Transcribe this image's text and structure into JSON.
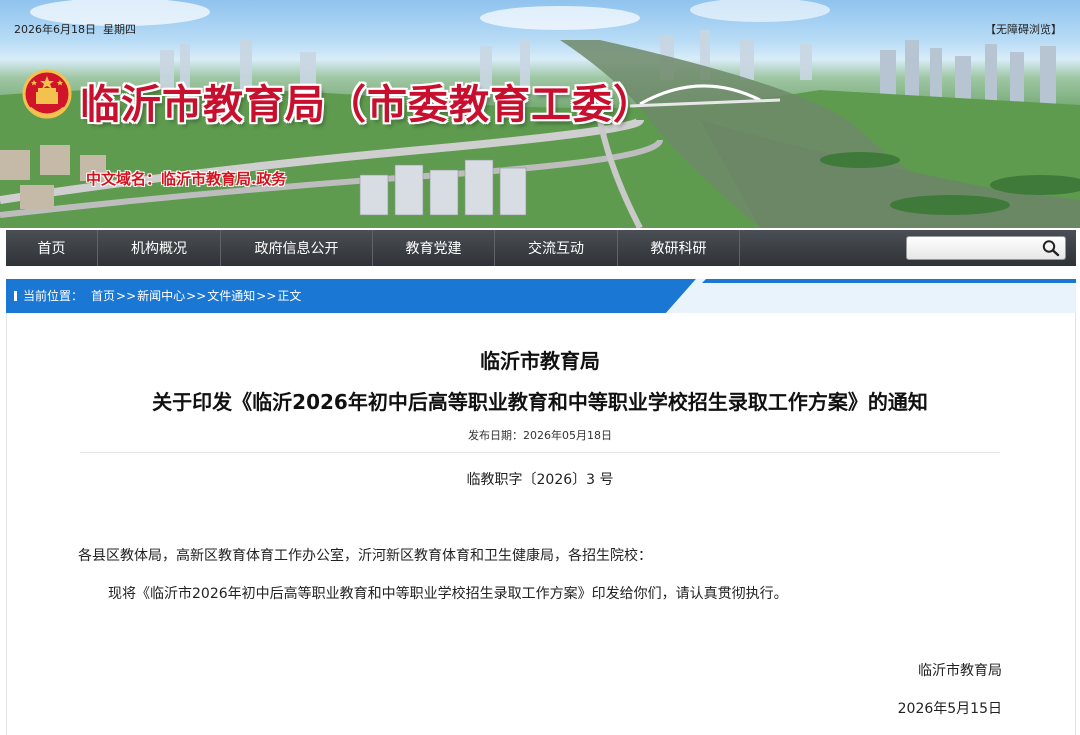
{
  "header": {
    "date": "2026年6月18日",
    "weekday": "星期四",
    "accessibility": "【无障碍浏览】",
    "site_title": "临沂市教育局（市委教育工委）",
    "domain_name": "中文域名：临沂市教育局.政务"
  },
  "nav": {
    "items": [
      {
        "label": "首页"
      },
      {
        "label": "机构概况"
      },
      {
        "label": "政府信息公开"
      },
      {
        "label": "教育党建"
      },
      {
        "label": "交流互动"
      },
      {
        "label": "教研科研"
      }
    ],
    "search_value": ""
  },
  "breadcrumb": {
    "label": "当前位置：",
    "items": [
      "首页",
      "新闻中心",
      "文件通知",
      "正文"
    ],
    "separator": ">>"
  },
  "article": {
    "org": "临沂市教育局",
    "title": "关于印发《临沂2026年初中后高等职业教育和中等职业学校招生录取工作方案》的通知",
    "publish_label": "发布日期：",
    "publish_date": "2026年05月18日",
    "doc_number": "临教职字〔2026〕3 号",
    "recipients": "各县区教体局，高新区教育体育工作办公室，沂河新区教育体育和卫生健康局，各招生院校：",
    "body": "现将《临沂市2026年初中后高等职业教育和中等职业学校招生录取工作方案》印发给你们，请认真贯彻执行。",
    "signature": "临沂市教育局",
    "sign_date": "2026年5月15日"
  },
  "colors": {
    "title_red": "#c8102e",
    "nav_bg": "#3a3f44",
    "breadcrumb_blue": "#1a78d4"
  }
}
